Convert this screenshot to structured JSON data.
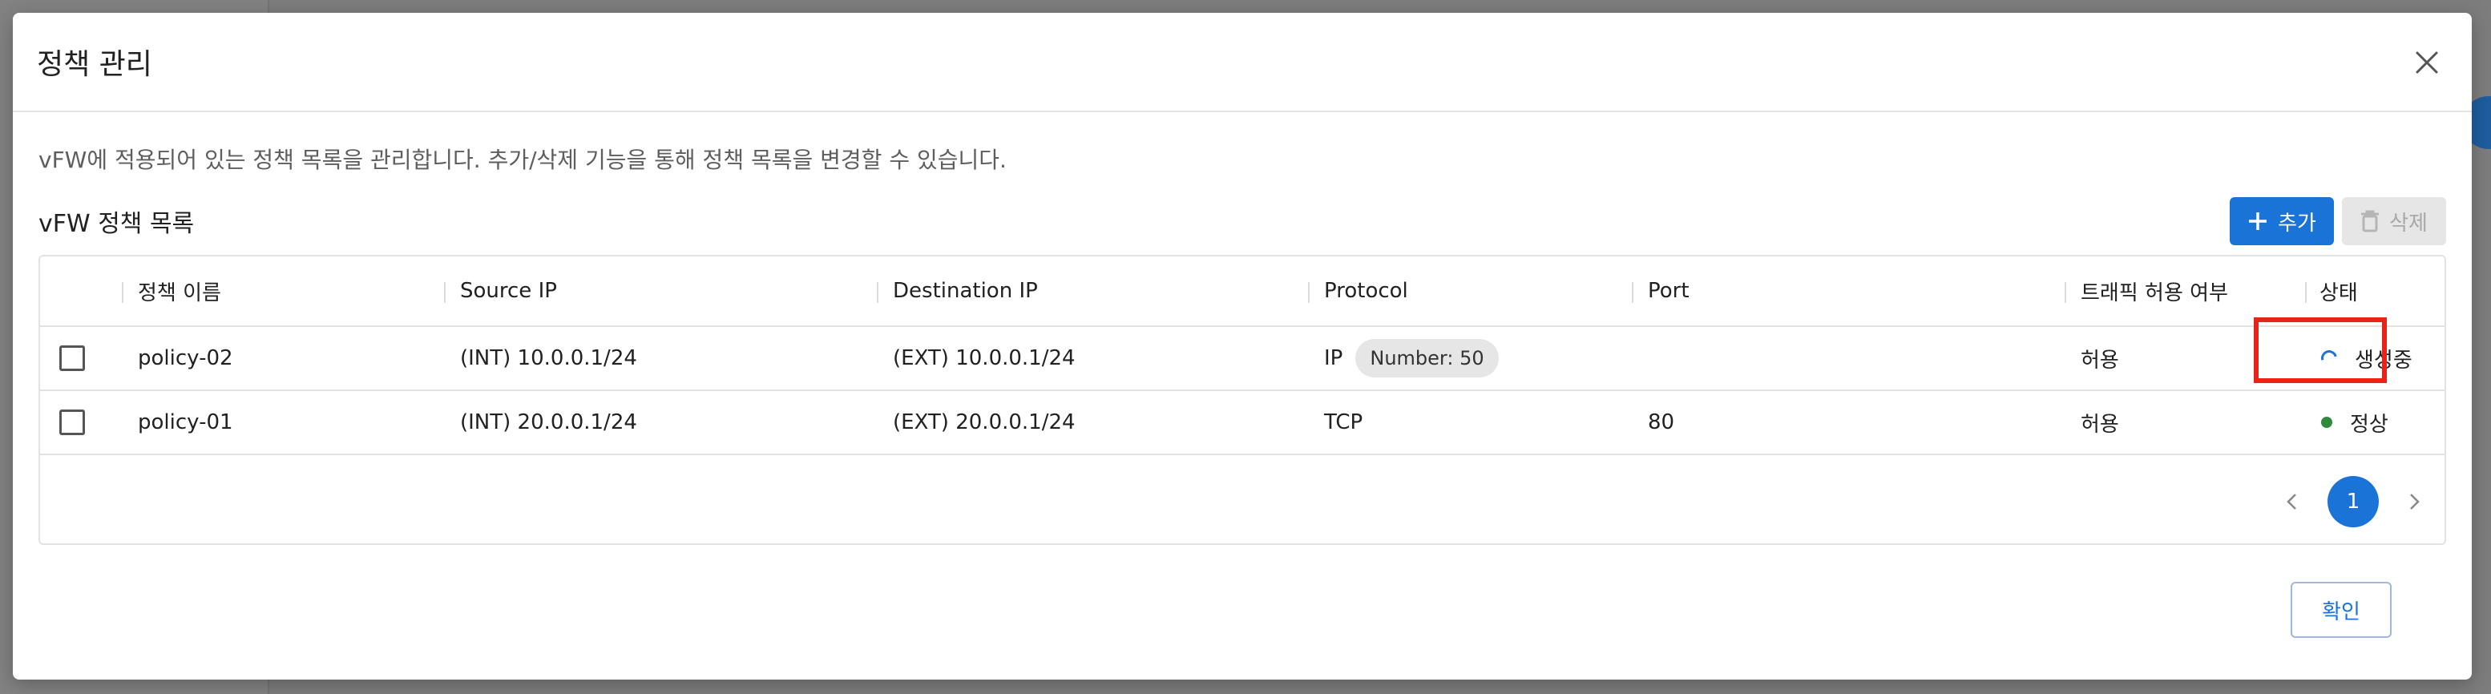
{
  "modal": {
    "title": "정책 관리",
    "description": "vFW에 적용되어 있는 정책 목록을 관리합니다. 추가/삭제 기능을 통해 정책 목록을 변경할 수 있습니다.",
    "list_title": "vFW 정책 목록",
    "add_label": "추가",
    "delete_label": "삭제",
    "confirm_label": "확인"
  },
  "table": {
    "headers": {
      "name": "정책 이름",
      "source": "Source IP",
      "destination": "Destination IP",
      "protocol": "Protocol",
      "port": "Port",
      "traffic": "트래픽 허용 여부",
      "status": "상태"
    },
    "rows": [
      {
        "name": "policy-02",
        "source": "(INT) 10.0.0.1/24",
        "destination": "(EXT) 10.0.0.1/24",
        "protocol": "IP",
        "protocol_chip": "Number: 50",
        "port": "",
        "traffic": "허용",
        "status": "생성중",
        "status_icon": "spinner-icon"
      },
      {
        "name": "policy-01",
        "source": "(INT) 20.0.0.1/24",
        "destination": "(EXT) 20.0.0.1/24",
        "protocol": "TCP",
        "protocol_chip": "",
        "port": "80",
        "traffic": "허용",
        "status": "정상",
        "status_icon": "green-dot-icon"
      }
    ]
  },
  "pagination": {
    "current_page": "1"
  },
  "colors": {
    "primary": "#1a73d6",
    "highlight": "#e8231b",
    "ok": "#2e8b3b"
  }
}
